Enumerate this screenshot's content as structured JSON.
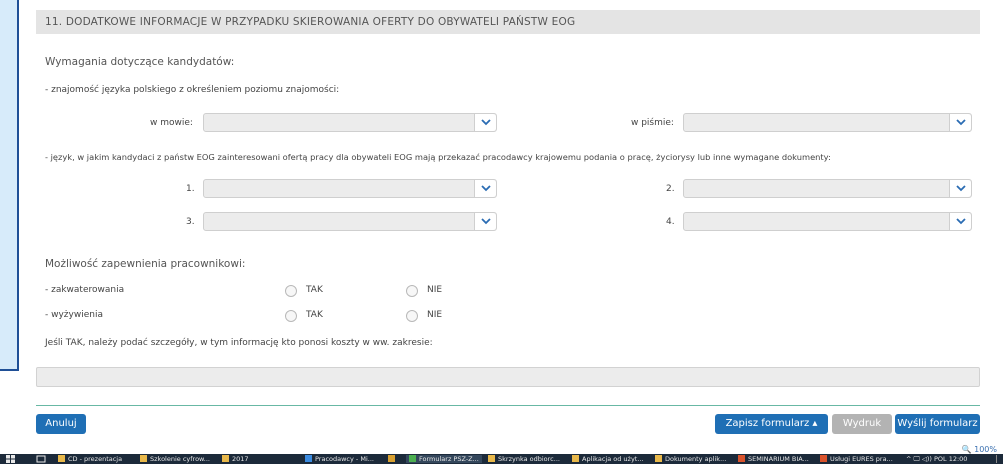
{
  "section": {
    "title": "11. DODATKOWE INFORMACJE W PRZYPADKU SKIEROWANIA OFERTY DO OBYWATELI PAŃSTW EOG"
  },
  "requirements": {
    "heading": "Wymagania dotyczące kandydatów:",
    "polish_label": "- znajomość języka polskiego z określeniem poziomu znajomości:",
    "speaking_label": "w mowie:",
    "writing_label": "w piśmie:",
    "speaking_value": "",
    "writing_value": "",
    "languages_label": "- język, w jakim kandydaci z państw EOG zainteresowani ofertą pracy dla obywateli EOG mają przekazać pracodawcy krajowemu podania o pracę, życiorysy lub inne wymagane dokumenty:",
    "languages": [
      {
        "label": "1.",
        "value": ""
      },
      {
        "label": "2.",
        "value": ""
      },
      {
        "label": "3.",
        "value": ""
      },
      {
        "label": "4.",
        "value": ""
      }
    ]
  },
  "provision": {
    "heading": "Możliwość zapewnienia pracownikowi:",
    "rows": [
      {
        "label": "- zakwaterowania",
        "yes": "TAK",
        "no": "NIE",
        "selected": null
      },
      {
        "label": "- wyżywienia",
        "yes": "TAK",
        "no": "NIE",
        "selected": null
      }
    ],
    "details_label": "Jeśli TAK, należy podać szczegóły, w tym informację kto ponosi koszty w ww. zakresie:",
    "details_value": ""
  },
  "actions": {
    "cancel": "Anuluj",
    "save": "Zapisz formularz ▴",
    "print": "Wydruk",
    "send": "Wyślij formularz"
  },
  "colors": {
    "primary": "#1f6fb5",
    "disabled": "#b3b3b3",
    "divider": "#68b8a4",
    "side_panel": "#d7ebfa"
  },
  "status": {
    "zoom": "🔍 100%"
  },
  "taskbar": {
    "items": [
      {
        "label": "CD - prezentacja",
        "icon": "folder-icon",
        "color": "#e8b84a"
      },
      {
        "label": "Szkolenie cyfrow...",
        "icon": "folder-icon",
        "color": "#e8b84a"
      },
      {
        "label": "2017",
        "icon": "folder-icon",
        "color": "#e8b84a"
      },
      {
        "label": "Pracodawcy - Mi...",
        "icon": "ie-icon",
        "color": "#3b8be0"
      },
      {
        "label": "",
        "icon": "app-icon",
        "color": "#d8a030"
      },
      {
        "label": "Formularz PSZ-Z...",
        "icon": "chrome-icon",
        "color": "#4caf50"
      },
      {
        "label": "Skrzynka odbiorc...",
        "icon": "mail-icon",
        "color": "#e8b84a"
      },
      {
        "label": "Aplikacja od użyt...",
        "icon": "folder-icon",
        "color": "#e8b84a"
      },
      {
        "label": "Dokumenty aplik...",
        "icon": "folder-icon",
        "color": "#e8b84a"
      },
      {
        "label": "SEMINARIUM BIA...",
        "icon": "ppt-icon",
        "color": "#d9532c"
      },
      {
        "label": "Usługi EURES pra...",
        "icon": "ppt-icon",
        "color": "#d9532c"
      }
    ],
    "tray": "^ 🖵 ◁)) POL 12:00"
  }
}
